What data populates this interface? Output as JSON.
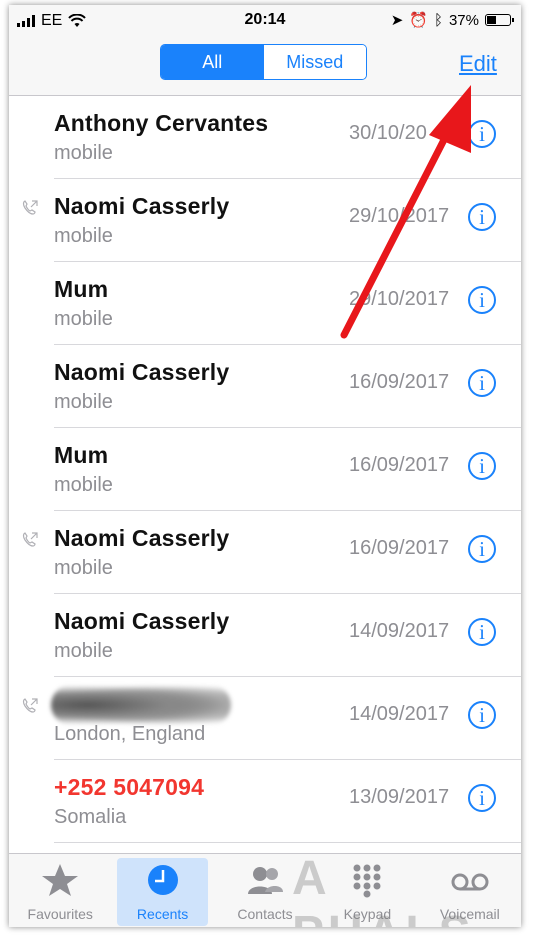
{
  "status_bar": {
    "carrier": "EE",
    "time": "20:14",
    "battery": "37%"
  },
  "nav": {
    "segments": [
      "All",
      "Missed"
    ],
    "selected_segment": "All",
    "edit_label": "Edit"
  },
  "calls": [
    {
      "name": "Anthony Cervantes",
      "detail": "mobile",
      "date": "30/10/20",
      "missed": false,
      "outgoing": false
    },
    {
      "name": "Naomi Casserly",
      "detail": "mobile",
      "date": "29/10/2017",
      "missed": false,
      "outgoing": true
    },
    {
      "name": "Mum",
      "detail": "mobile",
      "date": "29/10/2017",
      "missed": false,
      "outgoing": false
    },
    {
      "name": "Naomi Casserly",
      "detail": "mobile",
      "date": "16/09/2017",
      "missed": false,
      "outgoing": false
    },
    {
      "name": "Mum",
      "detail": "mobile",
      "date": "16/09/2017",
      "missed": false,
      "outgoing": false
    },
    {
      "name": "Naomi Casserly",
      "detail": "mobile",
      "date": "16/09/2017",
      "missed": false,
      "outgoing": true
    },
    {
      "name": "Naomi Casserly",
      "detail": "mobile",
      "date": "14/09/2017",
      "missed": false,
      "outgoing": false
    },
    {
      "name": "",
      "detail": "London, England",
      "date": "14/09/2017",
      "missed": false,
      "outgoing": true
    },
    {
      "name": "+252 5047094",
      "detail": "Somalia",
      "date": "13/09/2017",
      "missed": true,
      "outgoing": false
    }
  ],
  "tabs": [
    {
      "label": "Favourites",
      "icon": "star-icon"
    },
    {
      "label": "Recents",
      "icon": "clock-icon"
    },
    {
      "label": "Contacts",
      "icon": "contacts-icon"
    },
    {
      "label": "Keypad",
      "icon": "keypad-icon"
    },
    {
      "label": "Voicemail",
      "icon": "voicemail-icon"
    }
  ],
  "active_tab": "Recents",
  "colors": {
    "accent": "#1a82fb",
    "missed": "#f2362f",
    "annotation_arrow": "#e8171b"
  },
  "watermark": "A  PUALS"
}
